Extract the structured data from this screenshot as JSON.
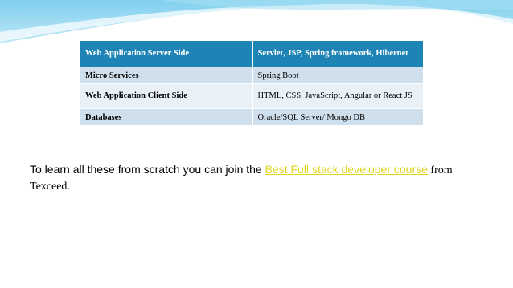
{
  "slide": {
    "accent_colors": {
      "header_row": "#1e84b5",
      "row_a": "#cfdfec",
      "row_b": "#e9f0f6",
      "link": "#e0d520"
    },
    "table": {
      "rows": [
        [
          "Web Application Server Side",
          "Servlet, JSP, Spring framework, Hibernet"
        ],
        [
          "Micro Services",
          "Spring Boot"
        ],
        [
          "Web Application Client Side",
          "HTML, CSS, JavaScript, Angular or React JS"
        ],
        [
          "Databases",
          "Oracle/SQL Server/ Mongo DB"
        ]
      ]
    },
    "caption": {
      "text_before": "To learn all these from scratch you can join the ",
      "link_text": "Best Full stack developer course",
      "text_after": " from Texceed."
    }
  }
}
